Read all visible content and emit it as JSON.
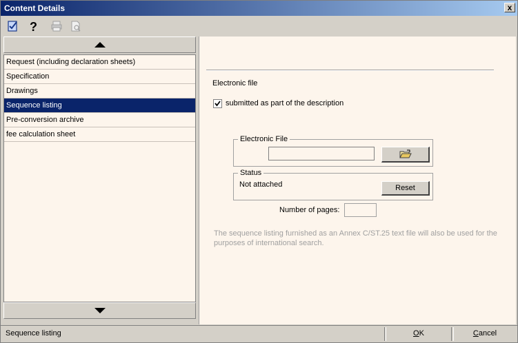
{
  "window": {
    "title": "Content Details",
    "close_label": "x"
  },
  "toolbar": {
    "icons": [
      "check-document-icon",
      "help-icon",
      "print-icon",
      "print-preview-icon"
    ]
  },
  "list": {
    "items": [
      {
        "label": "Request (including declaration sheets)",
        "selected": false
      },
      {
        "label": "Specification",
        "selected": false
      },
      {
        "label": "Drawings",
        "selected": false
      },
      {
        "label": "Sequence listing",
        "selected": true
      },
      {
        "label": "Pre-conversion archive",
        "selected": false
      },
      {
        "label": "fee calculation sheet",
        "selected": false
      }
    ]
  },
  "detail": {
    "section_title": "Electronic file",
    "checkbox_label": "submitted as part of the description",
    "checkbox_checked": true,
    "electronic_file_group": "Electronic File",
    "electronic_file_value": "",
    "status_group": "Status",
    "status_value": "Not attached",
    "reset_label": "Reset",
    "pages_label": "Number of pages:",
    "pages_value": "",
    "info_text": "The sequence listing furnished as an Annex C/ST.25 text file will also be used for the purposes of international search."
  },
  "statusbar": {
    "current": "Sequence listing",
    "ok_label": "OK",
    "cancel_label": "Cancel"
  },
  "colors": {
    "titlebar_start": "#0a246a",
    "titlebar_end": "#a6caf0",
    "selection": "#0a246a",
    "panel_bg": "#fdf5ec",
    "chrome": "#d4d0c8"
  }
}
